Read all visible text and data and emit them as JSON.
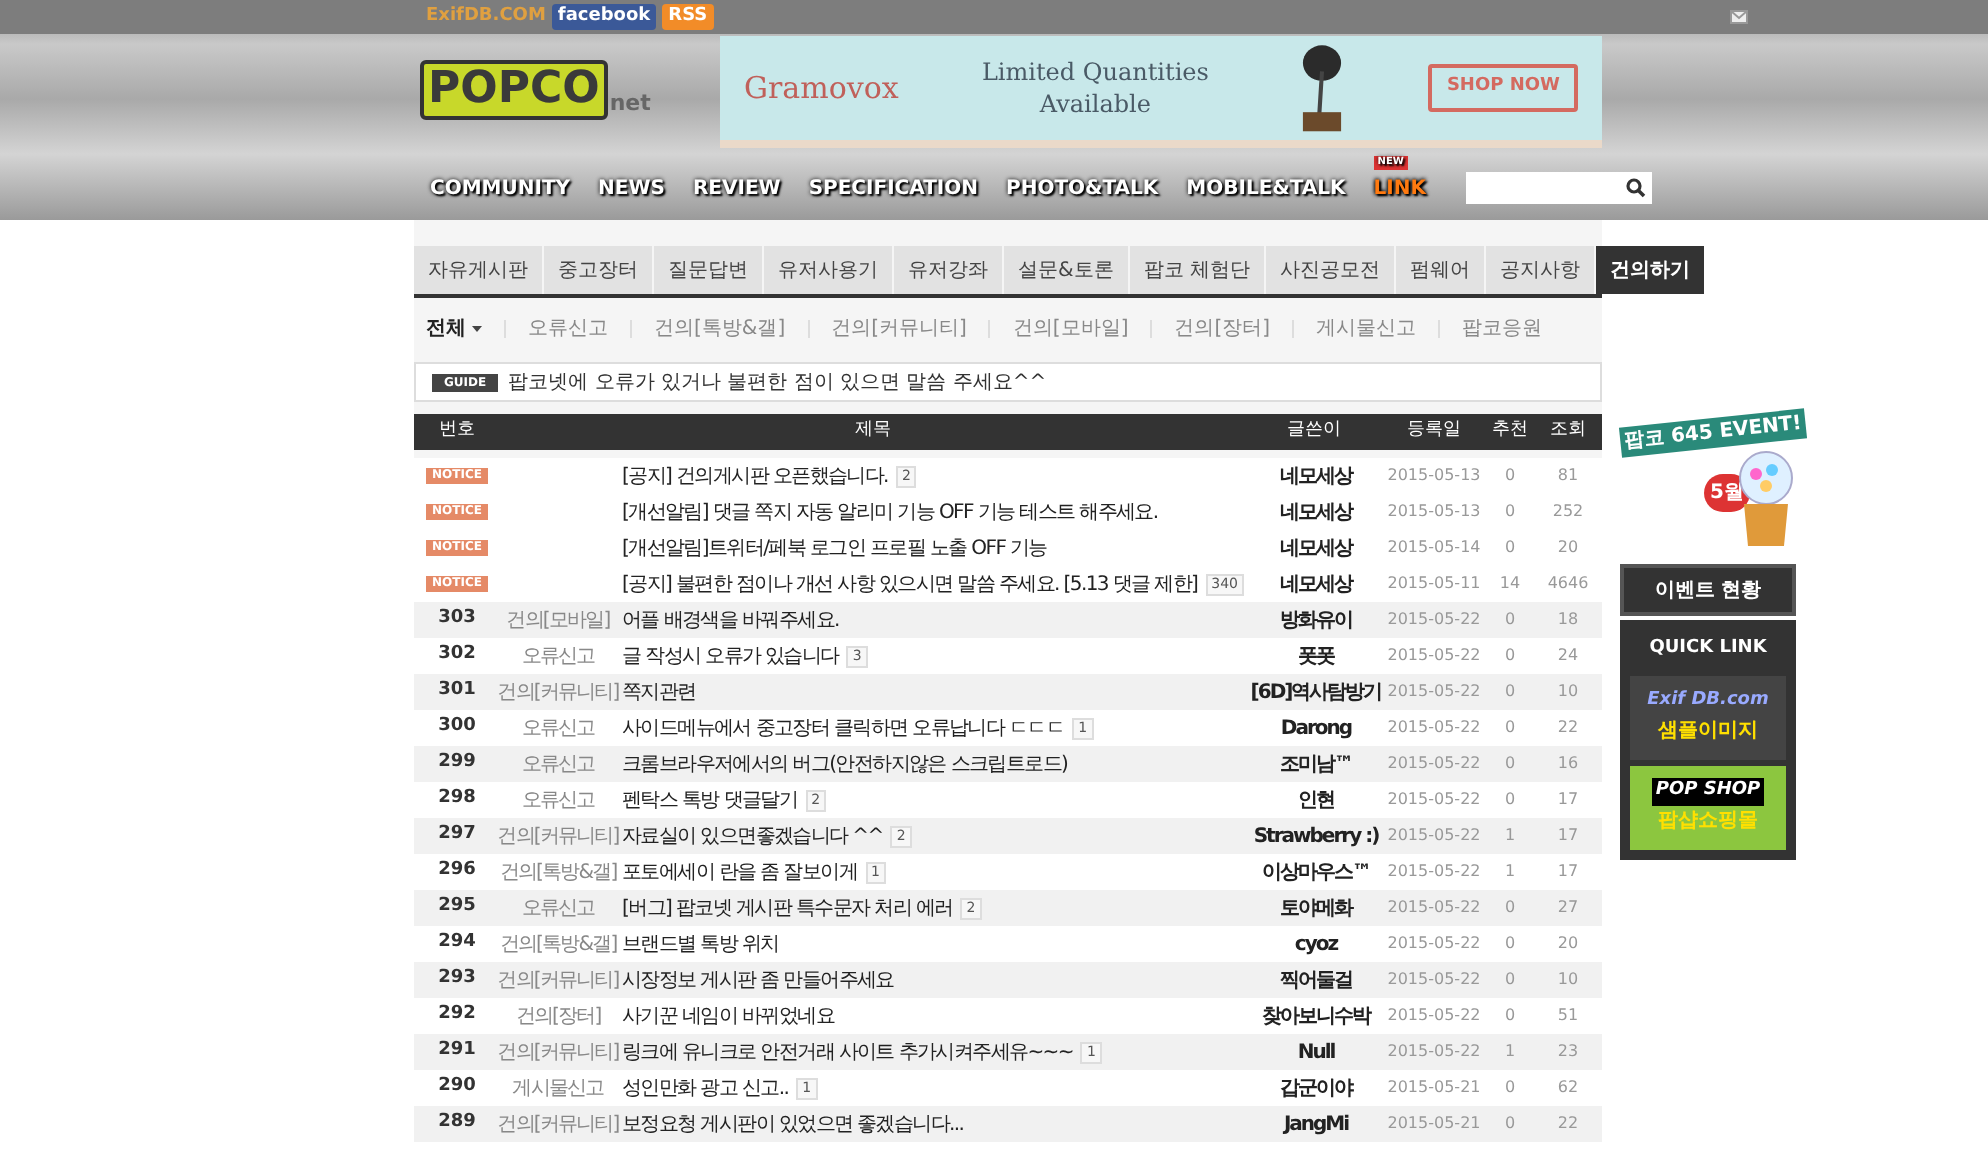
{
  "topbar": {
    "exifdb": "ExifDB.COM",
    "facebook": "facebook",
    "rss": "RSS"
  },
  "logo": {
    "name": "POPCO",
    "suffix": "net"
  },
  "ad": {
    "brand": "Gramovox",
    "headline": "Limited Quantities Available",
    "cta": "SHOP NOW"
  },
  "nav": [
    {
      "label": "COMMUNITY"
    },
    {
      "label": "NEWS"
    },
    {
      "label": "REVIEW"
    },
    {
      "label": "SPECIFICATION"
    },
    {
      "label": "PHOTO&TALK"
    },
    {
      "label": "MOBILE&TALK"
    },
    {
      "label": "LINK",
      "badge": "NEW"
    }
  ],
  "tabs": [
    {
      "label": "자유게시판",
      "selected": false
    },
    {
      "label": "중고장터",
      "selected": false
    },
    {
      "label": "질문답변",
      "selected": false
    },
    {
      "label": "유저사용기",
      "selected": false
    },
    {
      "label": "유저강좌",
      "selected": false
    },
    {
      "label": "설문&토론",
      "selected": false
    },
    {
      "label": "팝코 체험단",
      "selected": false
    },
    {
      "label": "사진공모전",
      "selected": false
    },
    {
      "label": "펌웨어",
      "selected": false
    },
    {
      "label": "공지사항",
      "selected": false
    },
    {
      "label": "건의하기",
      "selected": true
    }
  ],
  "subtabs": [
    {
      "label": "전체",
      "selected": true
    },
    {
      "label": "오류신고",
      "selected": false
    },
    {
      "label": "건의[톡방&갤]",
      "selected": false
    },
    {
      "label": "건의[커뮤니티]",
      "selected": false
    },
    {
      "label": "건의[모바일]",
      "selected": false
    },
    {
      "label": "건의[장터]",
      "selected": false
    },
    {
      "label": "게시물신고",
      "selected": false
    },
    {
      "label": "팝코응원",
      "selected": false
    }
  ],
  "guide": {
    "badge": "GUIDE",
    "text": "팝코넷에 오류가 있거나 불편한 점이 있으면 말씀 주세요^^"
  },
  "table": {
    "columns": [
      "번호",
      "제목",
      "글쓴이",
      "등록일",
      "추천",
      "조회"
    ],
    "rows": [
      {
        "kind": "notice",
        "number": "NOTICE",
        "subject": {
          "title": "[공지] 건의게시판 오픈했습니다.",
          "comments": "2"
        },
        "author": "네모세상",
        "date": "2015-05-13",
        "votes": "0",
        "views": "81"
      },
      {
        "kind": "notice",
        "number": "NOTICE",
        "subject": {
          "title": "[개선알림] 댓글 쪽지 자동 알리미 기능 OFF 기능 테스트 해주세요."
        },
        "author": "네모세상",
        "date": "2015-05-13",
        "votes": "0",
        "views": "252"
      },
      {
        "kind": "notice",
        "number": "NOTICE",
        "subject": {
          "title": "[개선알림]트위터/페북 로그인 프로필 노출 OFF 기능"
        },
        "author": "네모세상",
        "date": "2015-05-14",
        "votes": "0",
        "views": "20"
      },
      {
        "kind": "notice",
        "number": "NOTICE",
        "subject": {
          "title": "[공지] 불편한 점이나 개선 사항 있으시면 말씀 주세요. [5.13 댓글 제한]",
          "comments": "340"
        },
        "author": "네모세상",
        "date": "2015-05-11",
        "votes": "14",
        "views": "4646"
      },
      {
        "kind": "post",
        "number": "303",
        "category": "건의[모바일]",
        "subject": {
          "title": "어플 배경색을 바꿔주세요."
        },
        "author": "방화유이",
        "date": "2015-05-22",
        "votes": "0",
        "views": "18"
      },
      {
        "kind": "post",
        "number": "302",
        "category": "오류신고",
        "subject": {
          "title": "글 작성시 오류가 있습니다",
          "comments": "3"
        },
        "author": "폿폿",
        "date": "2015-05-22",
        "votes": "0",
        "views": "24"
      },
      {
        "kind": "post",
        "number": "301",
        "category": "건의[커뮤니티]",
        "subject": {
          "title": "쪽지관련"
        },
        "author": "[6D]역사탐방기",
        "date": "2015-05-22",
        "votes": "0",
        "views": "10"
      },
      {
        "kind": "post",
        "number": "300",
        "category": "오류신고",
        "subject": {
          "title": "사이드메뉴에서 중고장터 클릭하면 오류납니다 ㄷㄷㄷ",
          "comments": "1"
        },
        "author": "Darong",
        "date": "2015-05-22",
        "votes": "0",
        "views": "22"
      },
      {
        "kind": "post",
        "number": "299",
        "category": "오류신고",
        "subject": {
          "title": "크롬브라우저에서의 버그(안전하지않은 스크립트로드)"
        },
        "author": "조미남™",
        "date": "2015-05-22",
        "votes": "0",
        "views": "16"
      },
      {
        "kind": "post",
        "number": "298",
        "category": "오류신고",
        "subject": {
          "title": "펜탁스 톡방 댓글달기",
          "comments": "2"
        },
        "author": "인현",
        "date": "2015-05-22",
        "votes": "0",
        "views": "17"
      },
      {
        "kind": "post",
        "number": "297",
        "category": "건의[커뮤니티]",
        "subject": {
          "title": "자료실이 있으면좋겠습니다 ^^",
          "comments": "2"
        },
        "author": "Strawberry :)",
        "date": "2015-05-22",
        "votes": "1",
        "views": "17"
      },
      {
        "kind": "post",
        "number": "296",
        "category": "건의[톡방&갤]",
        "subject": {
          "title": "포토에세이 란을 좀 잘보이게",
          "comments": "1"
        },
        "author": "이상마우스™",
        "date": "2015-05-22",
        "votes": "1",
        "views": "17"
      },
      {
        "kind": "post",
        "number": "295",
        "category": "오류신고",
        "subject": {
          "title": "[버그] 팝코넷 게시판 특수문자 처리 에러",
          "comments": "2"
        },
        "author": "토야메화",
        "date": "2015-05-22",
        "votes": "0",
        "views": "27"
      },
      {
        "kind": "post",
        "number": "294",
        "category": "건의[톡방&갤]",
        "subject": {
          "title": "브랜드별 톡방 위치"
        },
        "author": "cyoz",
        "date": "2015-05-22",
        "votes": "0",
        "views": "20"
      },
      {
        "kind": "post",
        "number": "293",
        "category": "건의[커뮤니티]",
        "subject": {
          "title": "시장정보 게시판 좀 만들어주세요"
        },
        "author": "찍어둘걸",
        "date": "2015-05-22",
        "votes": "0",
        "views": "10"
      },
      {
        "kind": "post",
        "number": "292",
        "category": "건의[장터]",
        "subject": {
          "title": "사기꾼 네임이 바뀌었네요"
        },
        "author": "찾아보니수박",
        "date": "2015-05-22",
        "votes": "0",
        "views": "51"
      },
      {
        "kind": "post",
        "number": "291",
        "category": "건의[커뮤니티]",
        "subject": {
          "title": "링크에 유니크로 안전거래 사이트 추가시켜주세유~~~",
          "comments": "1"
        },
        "author": "Null",
        "date": "2015-05-22",
        "votes": "1",
        "views": "23"
      },
      {
        "kind": "post",
        "number": "290",
        "category": "게시물신고",
        "subject": {
          "title": "성인만화 광고 신고..",
          "comments": "1"
        },
        "author": "갑군이야",
        "date": "2015-05-21",
        "votes": "0",
        "views": "62"
      },
      {
        "kind": "post",
        "number": "289",
        "category": "건의[커뮤니티]",
        "subject": {
          "title": "보정요청 게시판이 있었으면 좋겠습니다..."
        },
        "author": "JangMi",
        "date": "2015-05-21",
        "votes": "0",
        "views": "22"
      }
    ]
  },
  "sidebar": {
    "event_banner": "팝코 645 EVENT!",
    "event_month": "5월",
    "event_button": "이벤트 현황",
    "quick_link_title": "QUICK LINK",
    "links": [
      {
        "title": "Exif DB.com",
        "subtitle": "샘플이미지"
      },
      {
        "title": "POP SHOP",
        "subtitle": "팝샵쇼핑몰"
      }
    ]
  }
}
